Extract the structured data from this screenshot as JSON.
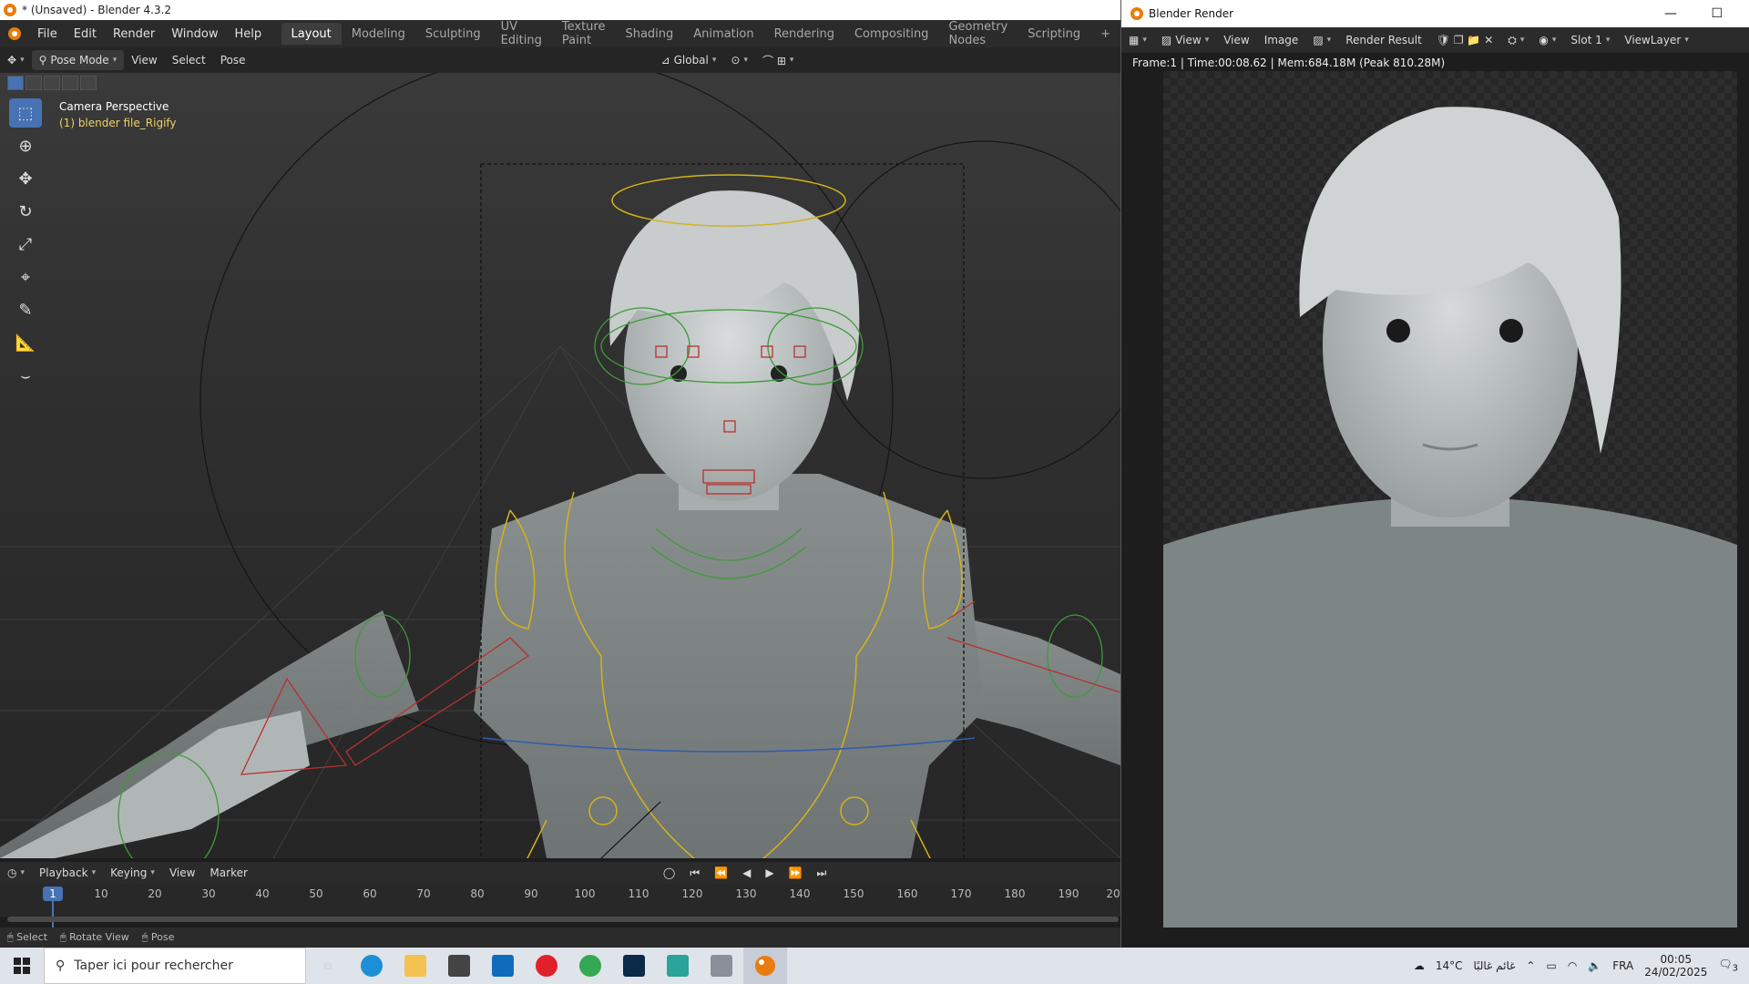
{
  "window": {
    "title": "* (Unsaved) - Blender 4.3.2"
  },
  "menu": [
    "File",
    "Edit",
    "Render",
    "Window",
    "Help"
  ],
  "workspaces": [
    "Layout",
    "Modeling",
    "Sculpting",
    "UV Editing",
    "Texture Paint",
    "Shading",
    "Animation",
    "Rendering",
    "Compositing",
    "Geometry Nodes",
    "Scripting",
    "+"
  ],
  "header": {
    "mode": "Pose Mode",
    "view": "View",
    "select": "Select",
    "pose": "Pose",
    "orientation": "Global"
  },
  "viewport": {
    "camera_label": "Camera Perspective",
    "object_label": "(1) blender file_Rigify"
  },
  "tools": [
    "select-box-icon",
    "cursor-icon",
    "move-icon",
    "rotate-icon",
    "scale-icon",
    "transform-icon",
    "annotate-icon",
    "measure-icon",
    "bone-bend-icon"
  ],
  "timeline": {
    "playback": "Playback",
    "keying": "Keying",
    "view": "View",
    "marker": "Marker",
    "current_frame": "1",
    "ticks": [
      "10",
      "20",
      "30",
      "40",
      "50",
      "60",
      "70",
      "80",
      "90",
      "100",
      "110",
      "120",
      "130",
      "140",
      "150",
      "160",
      "170",
      "180",
      "190",
      "20"
    ]
  },
  "status": {
    "select": "Select",
    "rotate_view": "Rotate View",
    "pose": "Pose"
  },
  "render_window": {
    "title": "Blender Render",
    "view1": "View",
    "view2": "View",
    "image": "Image",
    "result": "Render Result",
    "slot": "Slot 1",
    "view_layer": "ViewLayer",
    "info": "Frame:1 | Time:00:08.62 | Mem:684.18M (Peak 810.28M)"
  },
  "taskbar": {
    "search_placeholder": "Taper ici pour rechercher",
    "weather_temp": "14°C",
    "weather_text": "غائم غالبًا",
    "lang": "FRA",
    "time": "00:05",
    "date": "24/02/2025",
    "notifications": "3"
  },
  "colors": {
    "accent": "#4772b3",
    "blender_orange": "#e87d0d",
    "rig_yellow": "#d4b21a",
    "rig_green": "#3f9a3a",
    "rig_red": "#b83030"
  }
}
